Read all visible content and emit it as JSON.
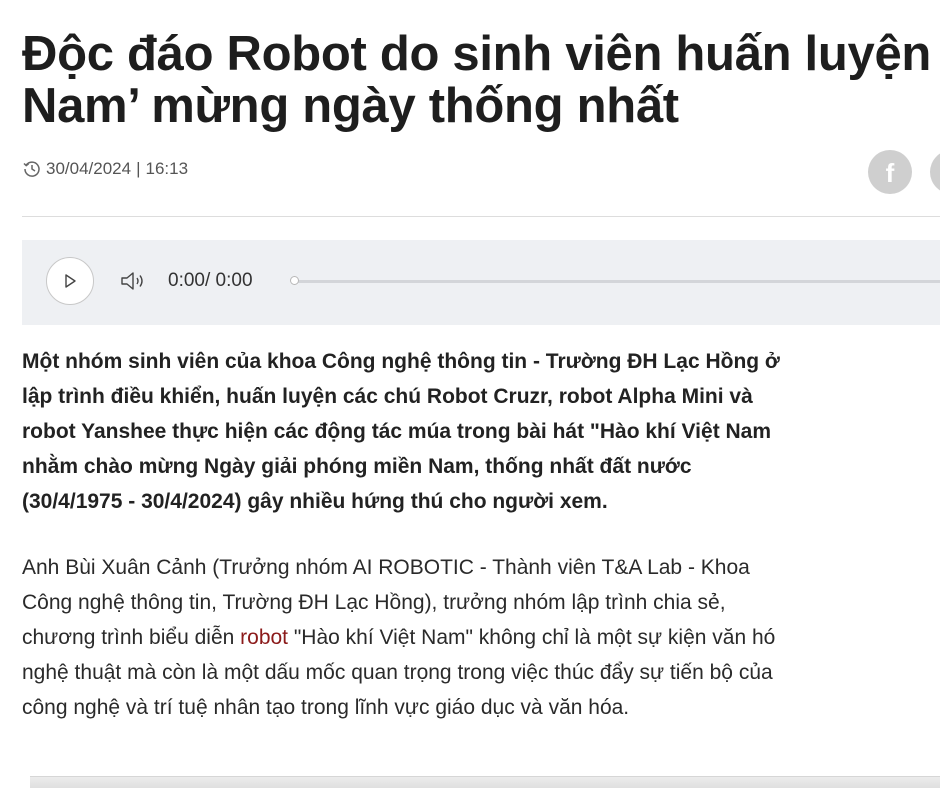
{
  "article": {
    "title_line1": "Độc đáo Robot do sinh viên huấn luyện",
    "title_line2": "Nam’ mừng ngày thống nhất",
    "date": "30/04/2024",
    "separator": "|",
    "time": "16:13",
    "share_icons": [
      "facebook-icon",
      "share-icon"
    ],
    "sapo_lines": [
      "Một nhóm sinh viên của khoa Công nghệ thông tin - Trường ĐH Lạc Hồng ở",
      "lập trình điều khiển, huấn luyện các chú Robot Cruzr, robot Alpha Mini và",
      "robot Yanshee thực hiện các động tác múa trong bài hát \"Hào khí Việt Nam",
      "nhằm chào mừng Ngày giải phóng miền Nam, thống nhất đất nước",
      "(30/4/1975 - 30/4/2024) gây nhiều hứng thú cho người xem."
    ],
    "body": {
      "line1": "Anh Bùi Xuân Cảnh (Trưởng nhóm AI ROBOTIC - Thành viên T&A Lab - Khoa",
      "line2": "Công nghệ thông tin, Trường ĐH Lạc Hồng), trưởng nhóm lập trình chia sẻ,",
      "line3_before": "chương trình biểu diễn ",
      "line3_link": "robot",
      "line3_after": " \"Hào khí Việt Nam\" không chỉ là một sự kiện văn hó",
      "line4": "nghệ thuật mà còn là một dấu mốc quan trọng trong việc thúc đẩy sự tiến bộ của",
      "line5": "công nghệ và trí tuệ nhân tạo trong lĩnh vực giáo dục và văn hóa."
    }
  },
  "audio_player": {
    "current_time": "0:00",
    "duration": "/ 0:00",
    "progress": 0,
    "icons": [
      "play-icon",
      "volume-icon"
    ]
  },
  "colors": {
    "link": "#8b1a1a",
    "player_bg": "#eef0f3",
    "share_bg": "#cfcfcf"
  }
}
